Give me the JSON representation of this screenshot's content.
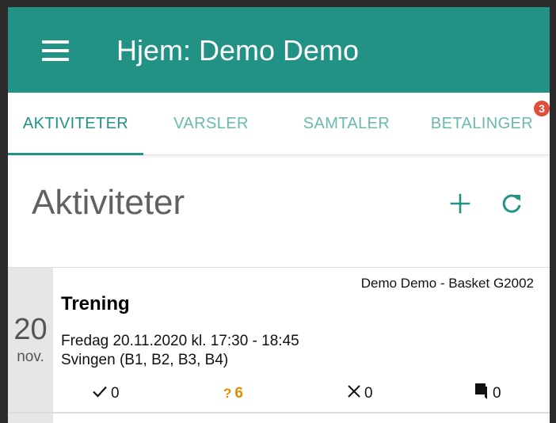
{
  "appbar": {
    "title": "Hjem: Demo Demo",
    "menu_icon": "hamburger-menu-icon",
    "color": "#219284"
  },
  "tabs": [
    {
      "label": "AKTIVITETER",
      "active": true
    },
    {
      "label": "VARSLER",
      "active": false
    },
    {
      "label": "SAMTALER",
      "active": false
    },
    {
      "label": "BETALINGER",
      "active": false,
      "badge": "3"
    }
  ],
  "section": {
    "title": "Aktiviteter",
    "add_icon": "plus-icon",
    "refresh_icon": "refresh-icon"
  },
  "activities": [
    {
      "day": "20",
      "month": "nov.",
      "team": "Demo Demo - Basket G2002",
      "title": "Trening",
      "time": "Fredag 20.11.2020 kl. 17:30 - 18:45",
      "location": "Svingen (B1, B2, B3, B4)",
      "stats": {
        "attending": "0",
        "unanswered": "6",
        "declined": "0",
        "comments": "0"
      }
    }
  ],
  "colors": {
    "accent": "#219284",
    "tab_inactive": "#6bb9ae",
    "badge": "#e04f3c",
    "unanswered": "#e68a00"
  }
}
